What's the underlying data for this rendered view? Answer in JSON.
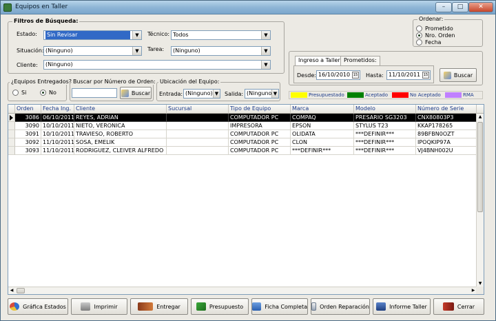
{
  "window": {
    "title": "Equipos en Taller",
    "controls": {
      "minimize": "–",
      "maximize": "□",
      "close": "✕"
    }
  },
  "filters": {
    "group_title": "Filtros de Búsqueda:",
    "estado": {
      "label": "Estado:",
      "value": "Sin Revisar"
    },
    "tecnico": {
      "label": "Técnico:",
      "value": "Todos"
    },
    "situacion": {
      "label": "Situación:",
      "value": "(Ninguno)"
    },
    "tarea": {
      "label": "Tarea:",
      "value": "(Ninguno)"
    },
    "cliente": {
      "label": "Cliente:",
      "value": "(Ninguno)"
    }
  },
  "ordenar": {
    "title": "Ordenar:",
    "options": [
      {
        "label": "Prometido",
        "checked": false
      },
      {
        "label": "Nro. Orden",
        "checked": true
      },
      {
        "label": "Fecha",
        "checked": false
      }
    ]
  },
  "ingreso": {
    "tabs": [
      "Ingreso a Taller:",
      "Prometidos:"
    ],
    "desde_label": "Desde:",
    "desde_value": "16/10/2010",
    "hasta_label": "Hasta:",
    "hasta_value": "11/10/2011",
    "buscar_label": "Buscar"
  },
  "entregados": {
    "title": "¿Equipos Entregados?",
    "options": [
      {
        "label": "Si",
        "checked": false
      },
      {
        "label": "No",
        "checked": true
      }
    ]
  },
  "buscar_orden": {
    "title": "Buscar por Número de Orden:",
    "value": "",
    "button_label": "Buscar"
  },
  "ubicacion": {
    "title": "Ubicación del Equipo:",
    "entrada_label": "Entrada:",
    "entrada_value": "(Ninguno)",
    "salida_label": "Salida:",
    "salida_value": "(Ninguno)"
  },
  "legend": [
    {
      "label": "Presupuestado",
      "color": "#ffff00"
    },
    {
      "label": "Aceptado",
      "color": "#008000"
    },
    {
      "label": "No Aceptado",
      "color": "#ff0000"
    },
    {
      "label": "RMA",
      "color": "#c080ff"
    }
  ],
  "table": {
    "columns": [
      "Orden",
      "Fecha Ing.",
      "Cliente",
      "Sucursal",
      "Tipo de Equipo",
      "Marca",
      "Modelo",
      "Número de Serie"
    ],
    "rows": [
      [
        "3086",
        "06/10/2011",
        "REYES, ADRIAN",
        "",
        "COMPUTADOR PC",
        "COMPAQ",
        "PRESARIO SG3203",
        "CNX80803P3"
      ],
      [
        "3090",
        "10/10/2011",
        "NIETO, VERONICA",
        "",
        "IMPRESORA",
        "EPSON",
        "STYLUS T23",
        "KKAP178265"
      ],
      [
        "3091",
        "10/10/2011",
        "TRAVIESO, ROBERTO",
        "",
        "COMPUTADOR PC",
        "OLIDATA",
        "***DEFINIR***",
        "89BFBN0OZT"
      ],
      [
        "3092",
        "11/10/2011",
        "SOSA, EMELIK",
        "",
        "COMPUTADOR PC",
        "CLON",
        "***DEFINIR***",
        "IPOQKIP97A"
      ],
      [
        "3093",
        "11/10/2011",
        "RODRIGUEZ, CLEIVER  ALFREDO",
        "",
        "COMPUTADOR PC",
        "***DEFINIR***",
        "***DEFINIR***",
        "VJ4BNH002U"
      ]
    ],
    "selected_row": 0
  },
  "actions": {
    "grafica": "Gráfica Estados",
    "imprimir": "Imprimir",
    "entregar": "Entregar",
    "presupuesto": "Presupuesto",
    "ficha": "Ficha Completa",
    "orden": "Orden Reparación",
    "informe": "Informe Taller",
    "cerrar": "Cerrar"
  }
}
